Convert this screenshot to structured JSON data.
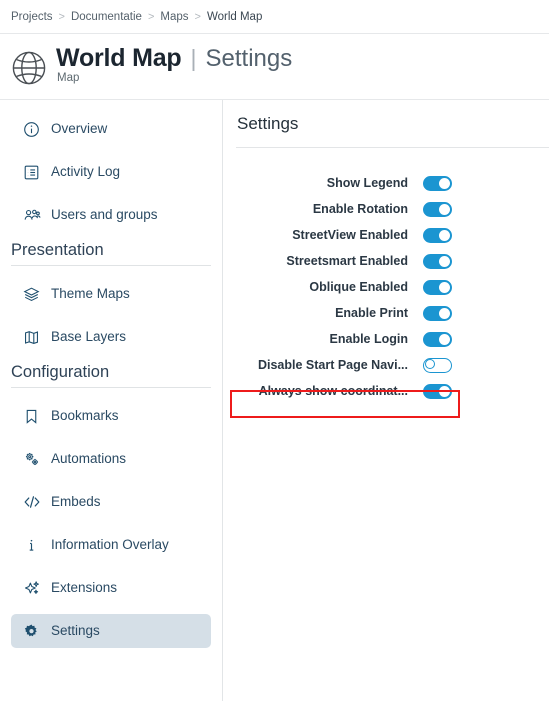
{
  "breadcrumb": {
    "separator": ">",
    "items": [
      {
        "label": "Projects"
      },
      {
        "label": "Documentatie"
      },
      {
        "label": "Maps"
      },
      {
        "label": "World Map"
      }
    ]
  },
  "header": {
    "icon": "globe-icon",
    "title": "World Map",
    "divider": "|",
    "subtitle": "Settings",
    "caption": "Map"
  },
  "sidebar": {
    "groups": [
      {
        "heading": null,
        "items": [
          {
            "label": "Overview",
            "icon": "info-circle-icon",
            "active": false
          },
          {
            "label": "Activity Log",
            "icon": "list-document-icon",
            "active": false
          },
          {
            "label": "Users and groups",
            "icon": "users-icon",
            "active": false
          }
        ]
      },
      {
        "heading": "Presentation",
        "items": [
          {
            "label": "Theme Maps",
            "icon": "layers-icon",
            "active": false
          },
          {
            "label": "Base Layers",
            "icon": "map-icon",
            "active": false
          }
        ]
      },
      {
        "heading": "Configuration",
        "items": [
          {
            "label": "Bookmarks",
            "icon": "bookmark-icon",
            "active": false
          },
          {
            "label": "Automations",
            "icon": "gears-icon",
            "active": false
          },
          {
            "label": "Embeds",
            "icon": "code-icon",
            "active": false
          },
          {
            "label": "Information Overlay",
            "icon": "info-i-icon",
            "active": false
          },
          {
            "label": "Extensions",
            "icon": "sparkles-icon",
            "active": false
          },
          {
            "label": "Settings",
            "icon": "gear-icon",
            "active": true
          }
        ]
      }
    ]
  },
  "content": {
    "title": "Settings",
    "settings": [
      {
        "label": "Show Legend",
        "state": "on"
      },
      {
        "label": "Enable Rotation",
        "state": "on"
      },
      {
        "label": "StreetView Enabled",
        "state": "on"
      },
      {
        "label": "Streetsmart Enabled",
        "state": "on"
      },
      {
        "label": "Oblique Enabled",
        "state": "on"
      },
      {
        "label": "Enable Print",
        "state": "on"
      },
      {
        "label": "Enable Login",
        "state": "on"
      },
      {
        "label": "Disable Start Page Navi...",
        "state": "off"
      },
      {
        "label": "Always show coordinat...",
        "state": "on"
      }
    ],
    "highlight": {
      "target_label": "Always show coordinat...",
      "color": "#ee1b1b"
    }
  },
  "colors": {
    "toggle_on": "#1b95d1",
    "toggle_off_border": "#1b95d1",
    "active_nav_bg": "#d5dfe7",
    "nav_text": "#2a4a63",
    "highlight": "#ee1b1b"
  }
}
